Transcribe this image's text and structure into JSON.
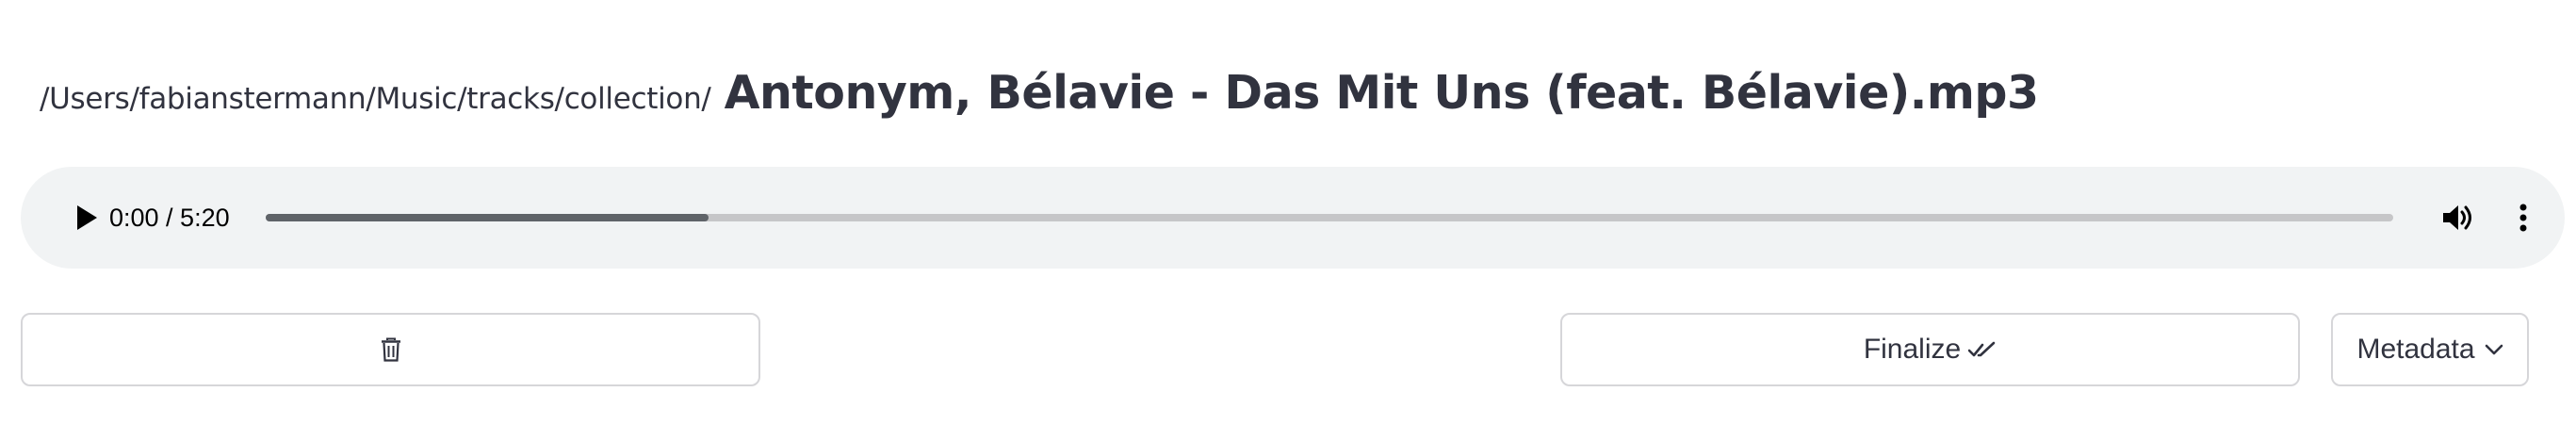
{
  "file": {
    "path": "/Users/fabianstermann/Music/tracks/collection/",
    "name": "Antonym, Bélavie - Das Mit Uns (feat. Bélavie).mp3"
  },
  "player": {
    "time": "0:00 / 5:20",
    "progress": 0.208,
    "icons": {
      "play": "play-icon",
      "volume": "volume-icon",
      "more": "more-vertical-icon"
    }
  },
  "actions": {
    "delete_icon": "trash-icon",
    "finalize_label": "Finalize",
    "finalize_icon": "double-check-icon",
    "metadata_label": "Metadata",
    "metadata_icon": "chevron-down-icon"
  }
}
